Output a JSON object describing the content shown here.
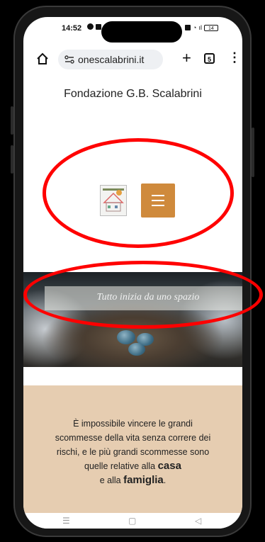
{
  "status": {
    "time": "14:52",
    "battery": "14"
  },
  "browser": {
    "url": "onescalabrini.it",
    "tab_count": "5",
    "new_tab_label": "+",
    "menu_label": "⋮"
  },
  "site": {
    "title": "Fondazione G.B. Scalabrini"
  },
  "hero": {
    "overlay_text": "Tutto inizia da uno spazio"
  },
  "quote": {
    "line1": "È impossibile vincere le grandi",
    "line2": "scommesse della vita senza correre dei",
    "line3": "rischi, e le più grandi scommesse sono",
    "line4_prefix": "quelle relative alla ",
    "line4_bold": "casa",
    "line5_prefix": "e alla ",
    "line5_bold": "famiglia",
    "line5_suffix": "."
  },
  "colors": {
    "accent": "#cf8a3c",
    "quote_bg": "#e6cdb1",
    "annotation": "#ff0000"
  },
  "icons": [
    "home-icon",
    "site-info-icon",
    "plus-icon",
    "tabs-icon",
    "overflow-menu-icon",
    "hamburger-icon",
    "recent-apps-icon",
    "home-nav-icon",
    "back-icon"
  ]
}
